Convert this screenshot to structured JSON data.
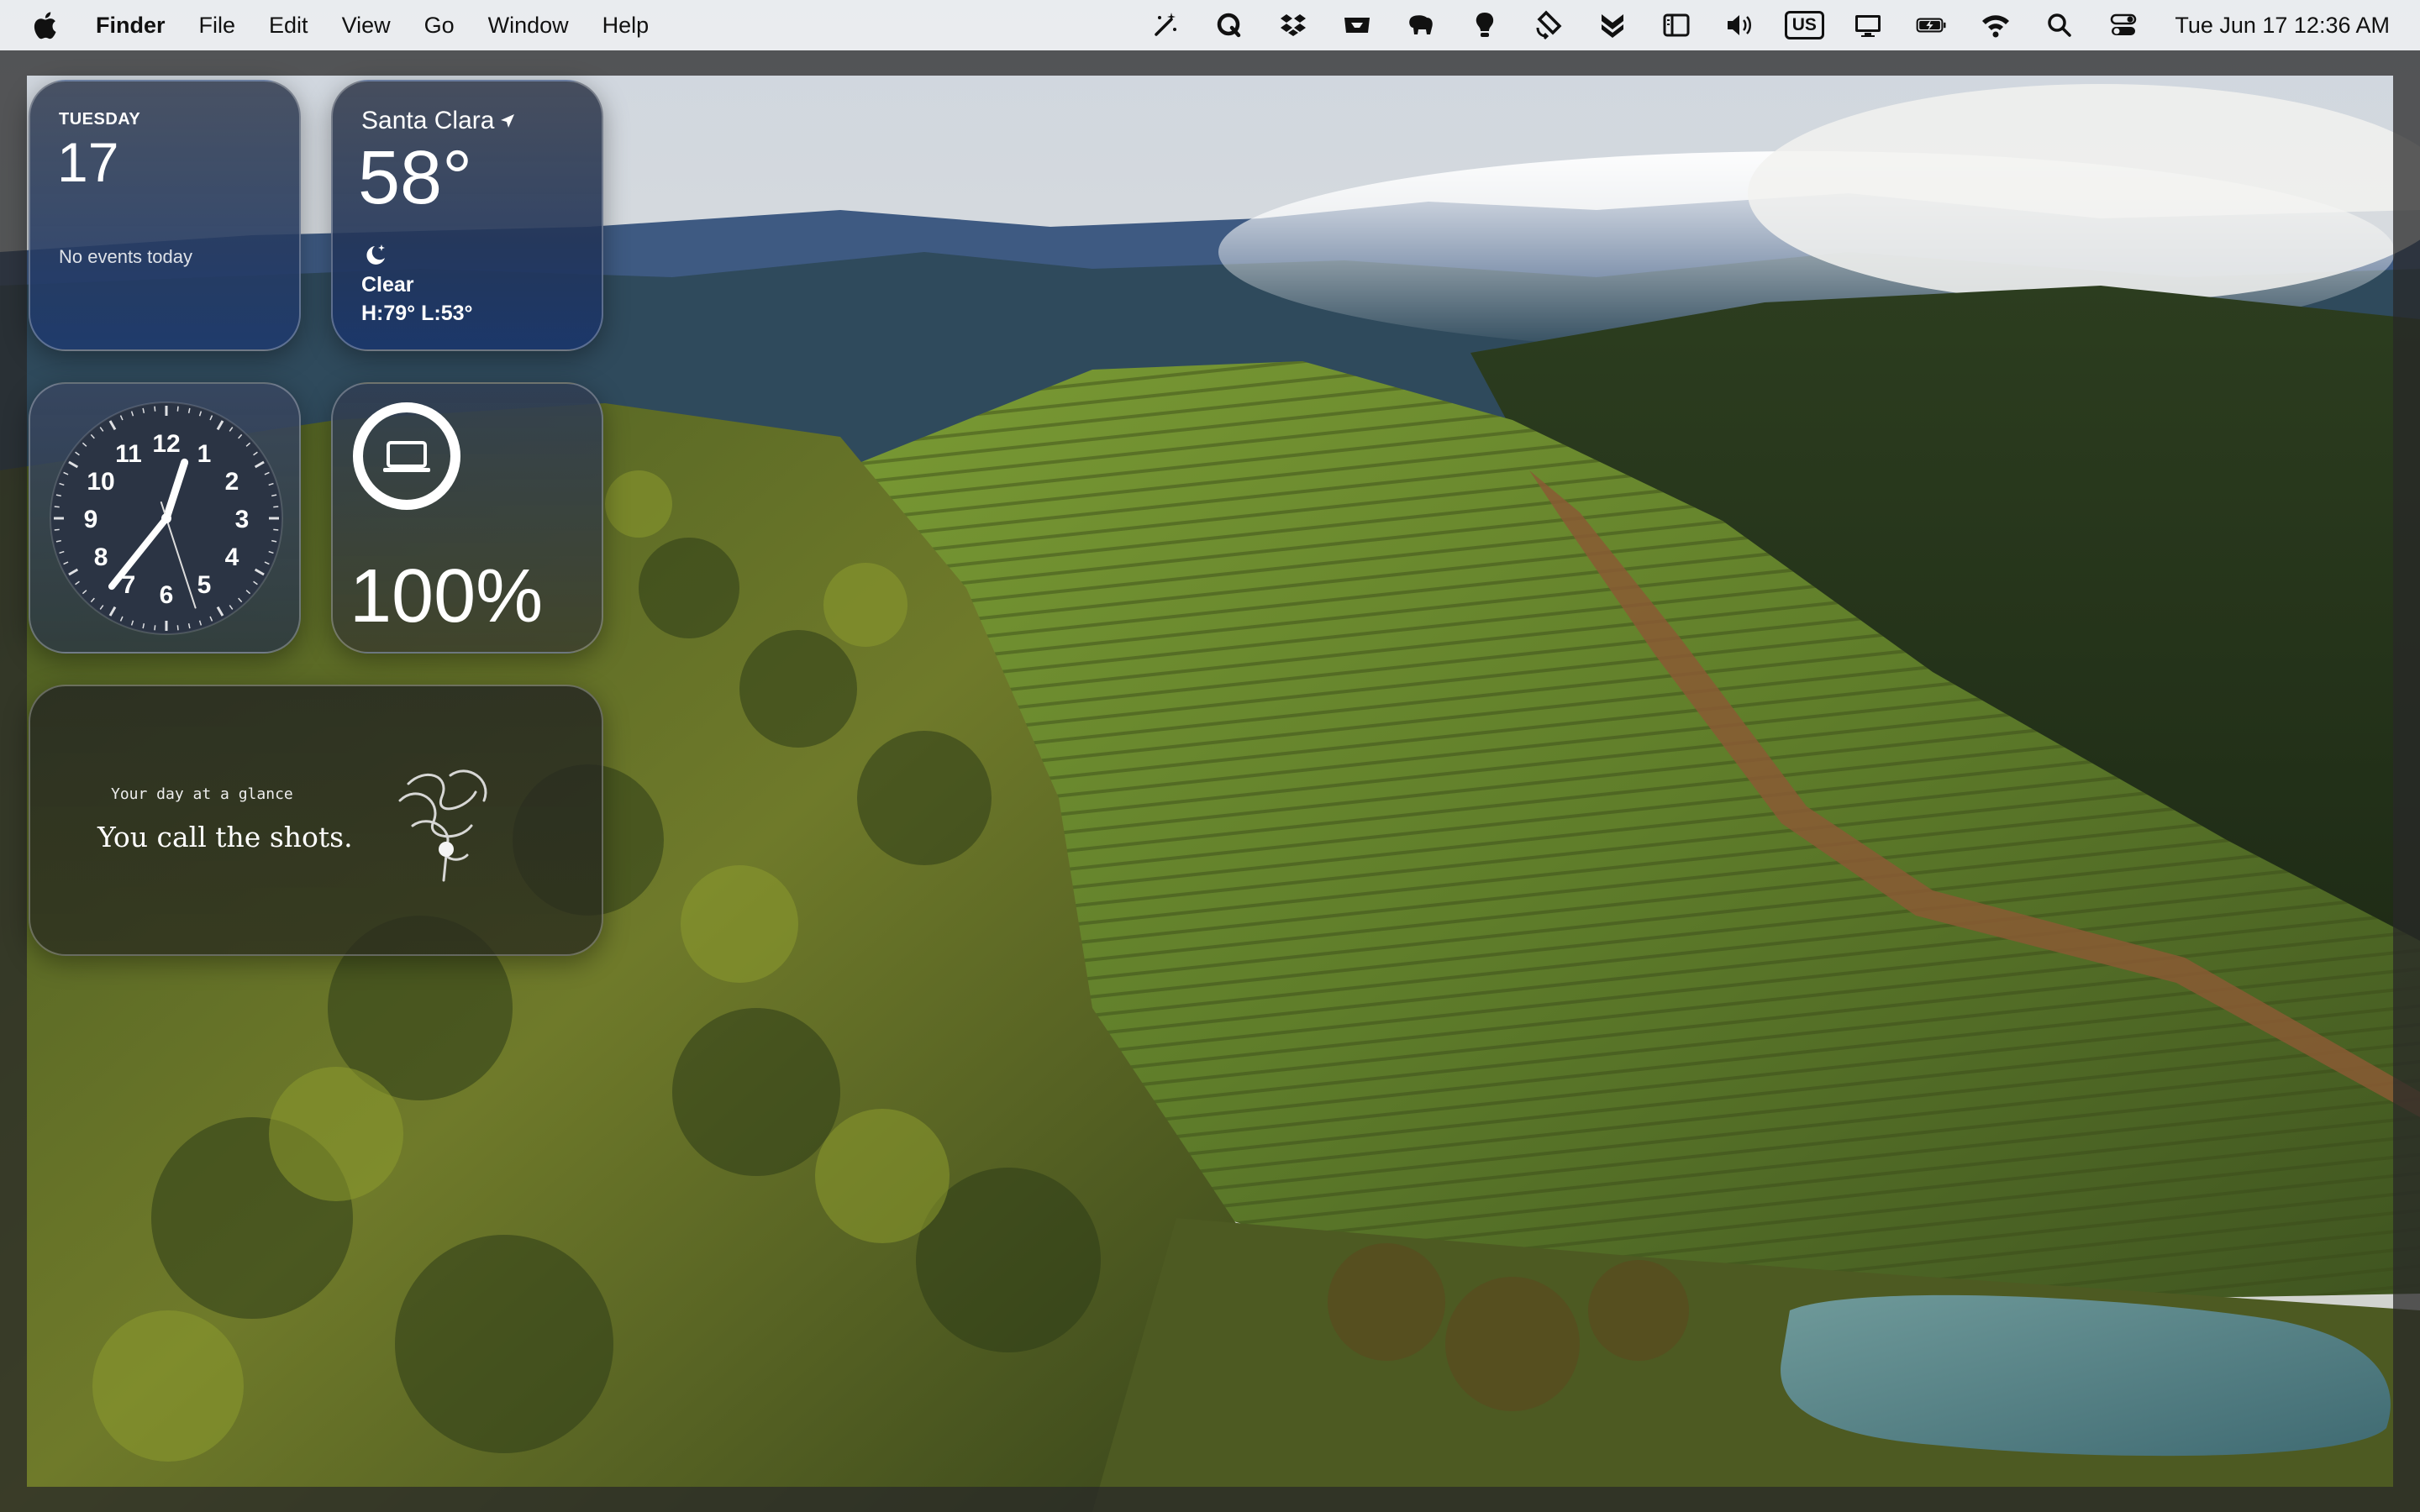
{
  "menubar": {
    "app_name": "Finder",
    "menus": [
      "File",
      "Edit",
      "View",
      "Go",
      "Window",
      "Help"
    ],
    "status_icons": [
      "magic-wand-icon",
      "q-app-icon",
      "dropbox-icon",
      "tray-app-icon",
      "elephant-app-icon",
      "lightbulb-app-icon",
      "rotate-app-icon",
      "double-chevron-app-icon",
      "sidebar-app-icon",
      "volume-icon",
      "keyboard-input-icon",
      "display-icon",
      "battery-charging-icon",
      "wifi-icon",
      "search-icon",
      "control-center-icon"
    ],
    "input_source": "US",
    "datetime": "Tue Jun 17  12:36 AM"
  },
  "widgets": {
    "calendar": {
      "weekday": "TUESDAY",
      "day": "17",
      "events_text": "No events today"
    },
    "weather": {
      "city": "Santa Clara",
      "temperature": "58°",
      "condition": "Clear",
      "high_low": "H:79° L:53°",
      "icon": "moon-stars-icon"
    },
    "clock": {
      "numerals": [
        "12",
        "1",
        "2",
        "3",
        "4",
        "5",
        "6",
        "7",
        "8",
        "9",
        "10",
        "11"
      ],
      "time": {
        "hour": 12,
        "minute": 36,
        "second": 27
      }
    },
    "battery": {
      "percent_text": "100%",
      "level": 1.0,
      "device_icon": "laptop-icon"
    },
    "glance": {
      "title": "Your day at a glance",
      "subtitle": "You call the shots."
    }
  },
  "colors": {
    "menubar_bg": "#eceef0",
    "widget_blue": "#1e3a6e"
  }
}
